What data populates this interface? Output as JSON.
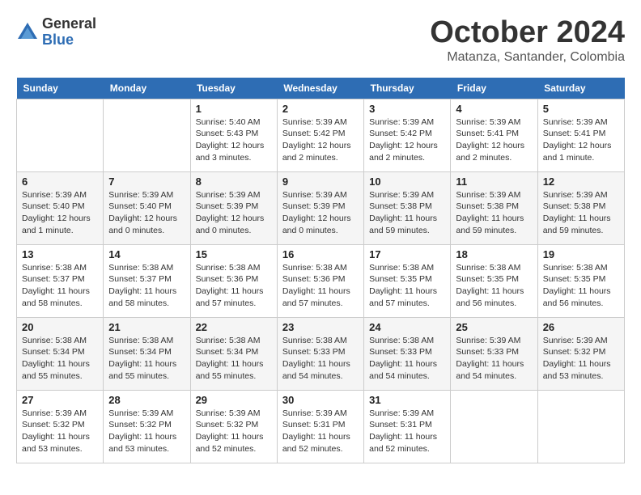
{
  "header": {
    "logo": {
      "general": "General",
      "blue": "Blue"
    },
    "title": "October 2024",
    "location": "Matanza, Santander, Colombia"
  },
  "calendar": {
    "days_of_week": [
      "Sunday",
      "Monday",
      "Tuesday",
      "Wednesday",
      "Thursday",
      "Friday",
      "Saturday"
    ],
    "weeks": [
      [
        {
          "day": "",
          "info": ""
        },
        {
          "day": "",
          "info": ""
        },
        {
          "day": "1",
          "info": "Sunrise: 5:40 AM\nSunset: 5:43 PM\nDaylight: 12 hours and 3 minutes."
        },
        {
          "day": "2",
          "info": "Sunrise: 5:39 AM\nSunset: 5:42 PM\nDaylight: 12 hours and 2 minutes."
        },
        {
          "day": "3",
          "info": "Sunrise: 5:39 AM\nSunset: 5:42 PM\nDaylight: 12 hours and 2 minutes."
        },
        {
          "day": "4",
          "info": "Sunrise: 5:39 AM\nSunset: 5:41 PM\nDaylight: 12 hours and 2 minutes."
        },
        {
          "day": "5",
          "info": "Sunrise: 5:39 AM\nSunset: 5:41 PM\nDaylight: 12 hours and 1 minute."
        }
      ],
      [
        {
          "day": "6",
          "info": "Sunrise: 5:39 AM\nSunset: 5:40 PM\nDaylight: 12 hours and 1 minute."
        },
        {
          "day": "7",
          "info": "Sunrise: 5:39 AM\nSunset: 5:40 PM\nDaylight: 12 hours and 0 minutes."
        },
        {
          "day": "8",
          "info": "Sunrise: 5:39 AM\nSunset: 5:39 PM\nDaylight: 12 hours and 0 minutes."
        },
        {
          "day": "9",
          "info": "Sunrise: 5:39 AM\nSunset: 5:39 PM\nDaylight: 12 hours and 0 minutes."
        },
        {
          "day": "10",
          "info": "Sunrise: 5:39 AM\nSunset: 5:38 PM\nDaylight: 11 hours and 59 minutes."
        },
        {
          "day": "11",
          "info": "Sunrise: 5:39 AM\nSunset: 5:38 PM\nDaylight: 11 hours and 59 minutes."
        },
        {
          "day": "12",
          "info": "Sunrise: 5:39 AM\nSunset: 5:38 PM\nDaylight: 11 hours and 59 minutes."
        }
      ],
      [
        {
          "day": "13",
          "info": "Sunrise: 5:38 AM\nSunset: 5:37 PM\nDaylight: 11 hours and 58 minutes."
        },
        {
          "day": "14",
          "info": "Sunrise: 5:38 AM\nSunset: 5:37 PM\nDaylight: 11 hours and 58 minutes."
        },
        {
          "day": "15",
          "info": "Sunrise: 5:38 AM\nSunset: 5:36 PM\nDaylight: 11 hours and 57 minutes."
        },
        {
          "day": "16",
          "info": "Sunrise: 5:38 AM\nSunset: 5:36 PM\nDaylight: 11 hours and 57 minutes."
        },
        {
          "day": "17",
          "info": "Sunrise: 5:38 AM\nSunset: 5:35 PM\nDaylight: 11 hours and 57 minutes."
        },
        {
          "day": "18",
          "info": "Sunrise: 5:38 AM\nSunset: 5:35 PM\nDaylight: 11 hours and 56 minutes."
        },
        {
          "day": "19",
          "info": "Sunrise: 5:38 AM\nSunset: 5:35 PM\nDaylight: 11 hours and 56 minutes."
        }
      ],
      [
        {
          "day": "20",
          "info": "Sunrise: 5:38 AM\nSunset: 5:34 PM\nDaylight: 11 hours and 55 minutes."
        },
        {
          "day": "21",
          "info": "Sunrise: 5:38 AM\nSunset: 5:34 PM\nDaylight: 11 hours and 55 minutes."
        },
        {
          "day": "22",
          "info": "Sunrise: 5:38 AM\nSunset: 5:34 PM\nDaylight: 11 hours and 55 minutes."
        },
        {
          "day": "23",
          "info": "Sunrise: 5:38 AM\nSunset: 5:33 PM\nDaylight: 11 hours and 54 minutes."
        },
        {
          "day": "24",
          "info": "Sunrise: 5:38 AM\nSunset: 5:33 PM\nDaylight: 11 hours and 54 minutes."
        },
        {
          "day": "25",
          "info": "Sunrise: 5:39 AM\nSunset: 5:33 PM\nDaylight: 11 hours and 54 minutes."
        },
        {
          "day": "26",
          "info": "Sunrise: 5:39 AM\nSunset: 5:32 PM\nDaylight: 11 hours and 53 minutes."
        }
      ],
      [
        {
          "day": "27",
          "info": "Sunrise: 5:39 AM\nSunset: 5:32 PM\nDaylight: 11 hours and 53 minutes."
        },
        {
          "day": "28",
          "info": "Sunrise: 5:39 AM\nSunset: 5:32 PM\nDaylight: 11 hours and 53 minutes."
        },
        {
          "day": "29",
          "info": "Sunrise: 5:39 AM\nSunset: 5:32 PM\nDaylight: 11 hours and 52 minutes."
        },
        {
          "day": "30",
          "info": "Sunrise: 5:39 AM\nSunset: 5:31 PM\nDaylight: 11 hours and 52 minutes."
        },
        {
          "day": "31",
          "info": "Sunrise: 5:39 AM\nSunset: 5:31 PM\nDaylight: 11 hours and 52 minutes."
        },
        {
          "day": "",
          "info": ""
        },
        {
          "day": "",
          "info": ""
        }
      ]
    ]
  }
}
